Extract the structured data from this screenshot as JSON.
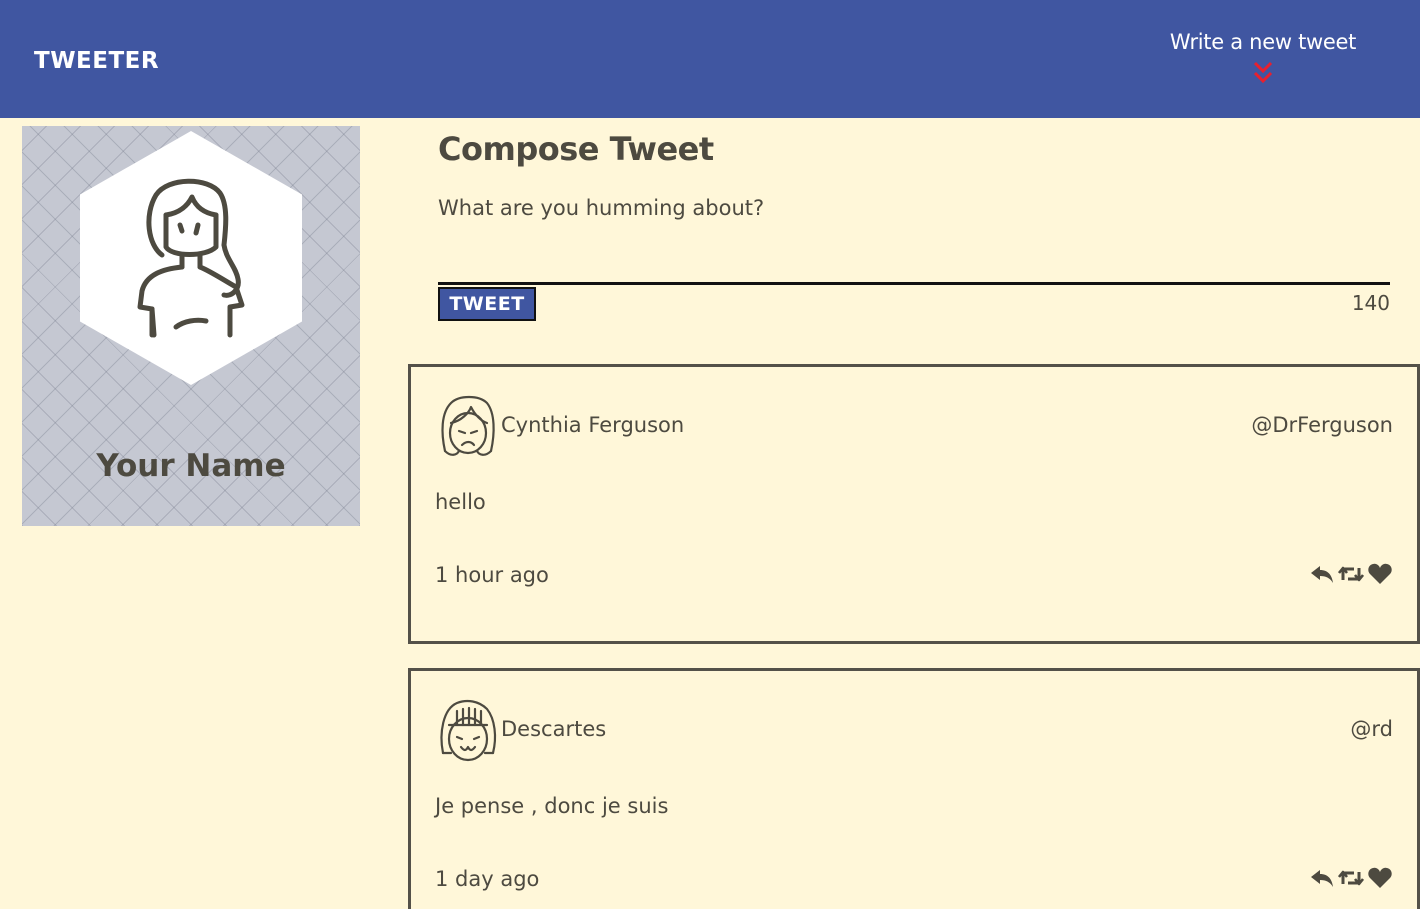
{
  "nav": {
    "brand": "TWEETER",
    "compose_link": "Write a new tweet",
    "chevron_icon": "double-chevron-down-icon",
    "chevron_color": "#e8202e",
    "background": "#4056a1"
  },
  "profile": {
    "name": "Your Name",
    "avatar_icon": "woman-avatar-icon"
  },
  "compose": {
    "title": "Compose Tweet",
    "placeholder": "What are you humming about?",
    "button_label": "TWEET",
    "counter": "140"
  },
  "tweets": [
    {
      "author": "Cynthia Ferguson",
      "handle": "@DrFerguson",
      "text": "hello",
      "time": "1 hour ago",
      "avatar_icon": "sad-girl-avatar-icon"
    },
    {
      "author": "Descartes",
      "handle": "@rd",
      "text": "Je pense , donc je suis",
      "time": "1 day ago",
      "avatar_icon": "smiling-girl-avatar-icon"
    }
  ],
  "actions": [
    "reply-icon",
    "retweet-icon",
    "heart-icon"
  ],
  "colors": {
    "page_background": "#fff7d9",
    "text": "#4d4a40",
    "card_border": "#545149",
    "profile_background": "#c5c8d2"
  }
}
